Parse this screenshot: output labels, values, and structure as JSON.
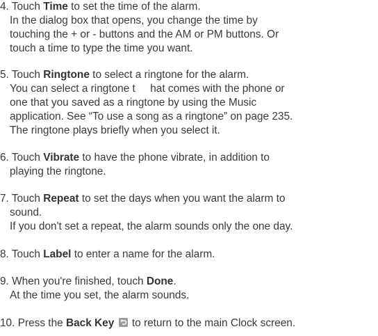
{
  "steps": [
    {
      "num": "4.",
      "pre": "Touch",
      "keyword": "Time",
      "post": "to set the time of the alarm.",
      "cont": [
        "In the dialog box that opens, you change the time by",
        "touching the + or - buttons and the AM or PM buttons. Or",
        "touch a time to type the time you want."
      ]
    },
    {
      "num": "5.",
      "pre": "Touch",
      "keyword": "Ringtone",
      "post": "to select a ringtone for the alarm.",
      "cont": [
        "You can select a ringtone t     hat comes with the phone or",
        "one that you saved as a ringtone by using the Music",
        "application. See “To use a song as a ringtone” on page 235.",
        "The ringtone plays briefly when you select it."
      ]
    },
    {
      "num": "6.",
      "pre": "Touch",
      "keyword": "Vibrate",
      "post": "to have the phone vibrate, in addition to",
      "cont": [
        "playing the ringtone."
      ]
    },
    {
      "num": "7.",
      "pre": "Touch",
      "keyword": "Repeat",
      "post": "to set the days when you want the alarm to",
      "cont": [
        "sound.",
        "If you don't set a repeat, the alarm sounds only the one day."
      ]
    },
    {
      "num": "8.",
      "pre": "Touch",
      "keyword": "Label",
      "post": "to enter a name for the alarm.",
      "cont": []
    },
    {
      "num": "9.",
      "pre": "When you're finished, touch",
      "keyword": "Done",
      "post": ".",
      "cont": [
        "At the time you set, the alarm sounds."
      ]
    },
    {
      "num": "10.",
      "pre": "Press the",
      "keyword": "Back Key",
      "icon": "back-arrow-icon",
      "post": "to return to the main Clock screen.",
      "cont": []
    }
  ]
}
